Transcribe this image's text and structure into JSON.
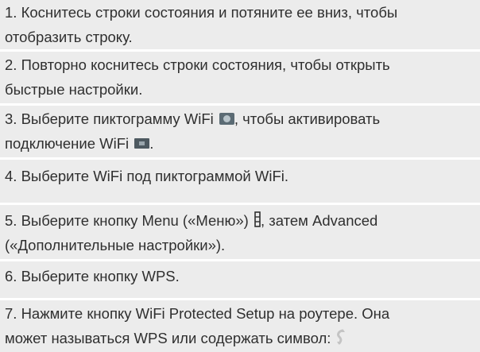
{
  "steps": [
    {
      "lines": [
        "1. Коснитесь строки состояния и потяните ее вниз, чтобы",
        "отобразить строку."
      ]
    },
    {
      "lines": [
        "2. Повторно коснитесь строки состояния, чтобы открыть",
        "быстрые настройки."
      ]
    },
    {
      "line1_before_icon": "3. Выберите пиктограмму WiFi ",
      "line1_after_icon": ", чтобы активировать",
      "line2_before_icon": "подключение WiFi ",
      "line2_after_icon": ".",
      "icons": [
        "wifi-settings-icon",
        "wifi-toggle-icon"
      ]
    },
    {
      "lines": [
        "4. Выберите WiFi под пиктограммой WiFi."
      ]
    },
    {
      "line1_before_icon": "5. Выберите кнопку Menu («Меню») ",
      "line1_after_icon": ", затем Advanced",
      "line2": "(«Дополнительные настройки»).",
      "icons": [
        "menu-icon"
      ]
    },
    {
      "lines": [
        "6. Выберите кнопку WPS."
      ]
    },
    {
      "line1": "7. Нажмите кнопку WiFi Protected Setup на роутере. Она",
      "line2_before_icon": "может называться WPS или содержать символ:",
      "icons": [
        "wps-symbol-icon"
      ]
    }
  ]
}
